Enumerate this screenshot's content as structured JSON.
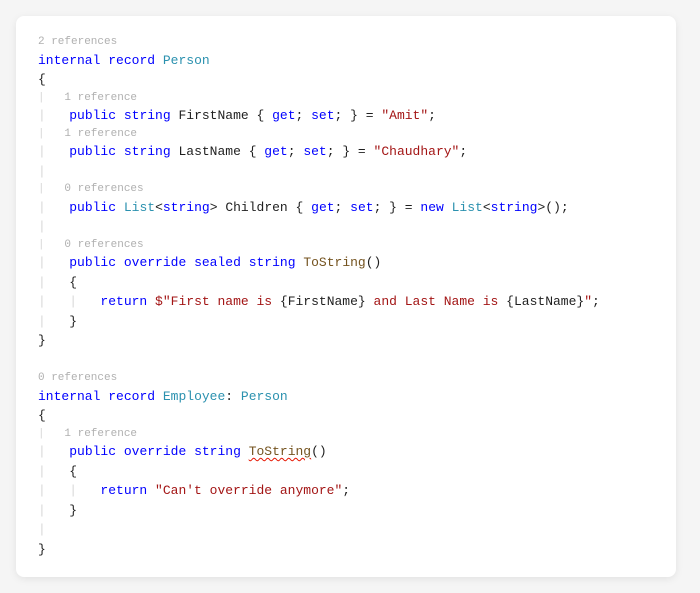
{
  "codelens": {
    "person": "2 references",
    "firstName": "1 reference",
    "lastName": "1 reference",
    "children": "0 references",
    "toString1": "0 references",
    "employee": "0 references",
    "toString2": "1 reference"
  },
  "kw": {
    "internal": "internal",
    "record": "record",
    "public": "public",
    "string": "string",
    "get": "get",
    "set": "set",
    "new": "new",
    "override": "override",
    "sealed": "sealed",
    "return": "return"
  },
  "types": {
    "Person": "Person",
    "List": "List",
    "Employee": "Employee"
  },
  "idents": {
    "FirstName": "FirstName",
    "LastName": "LastName",
    "Children": "Children",
    "ToString": "ToString"
  },
  "strings": {
    "amit": "\"Amit\"",
    "chaudhary": "\"Chaudhary\"",
    "interp1": "\"First name is ",
    "interp2": " and Last Name is ",
    "interp3": "\"",
    "cant": "\"Can't override anymore\""
  },
  "punct": {
    "obrace": "{",
    "cbrace": "}",
    "autoGetSet": " { ",
    "closeAuto": " } = ",
    "semi": ";",
    "lt": "<",
    "gt": ">",
    "parens": "()",
    "oparen": "(",
    "cparen": ")",
    "colon": ": ",
    "dollar": "$",
    "interpO": "{",
    "interpC": "}"
  }
}
